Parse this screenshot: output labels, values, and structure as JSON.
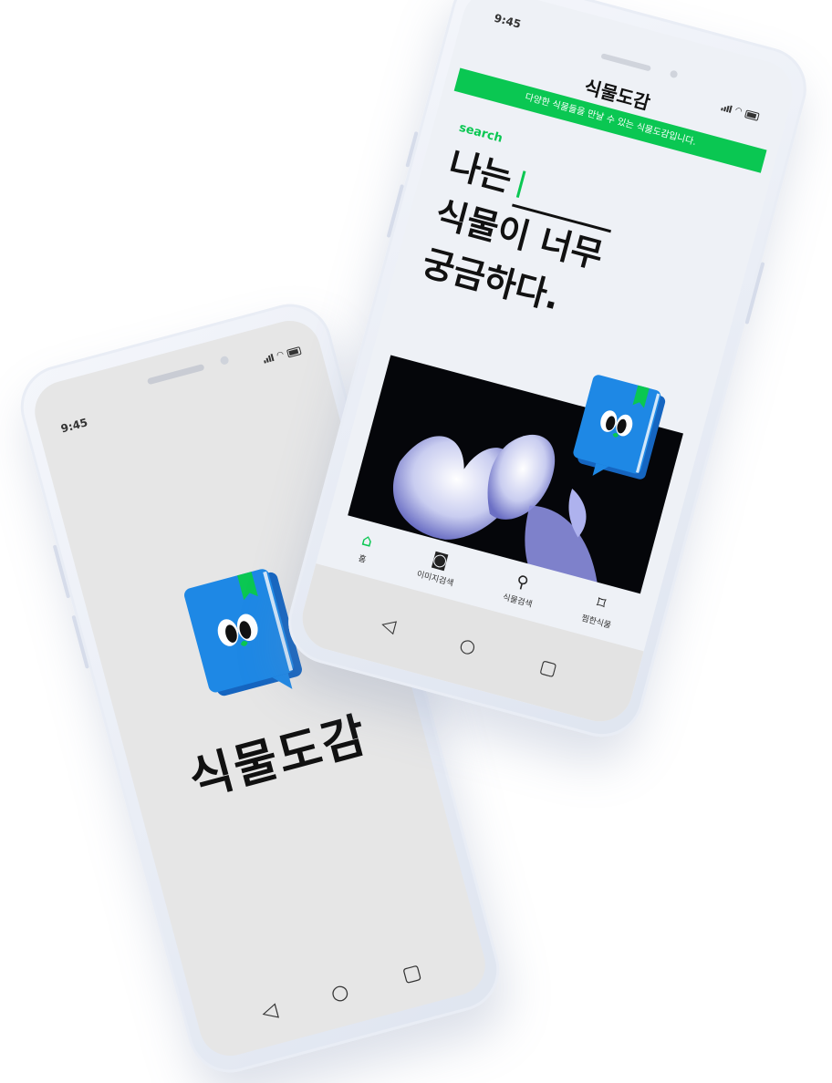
{
  "splash_phone": {
    "time": "9:45",
    "app_name": "식물도감",
    "nav": {
      "back_icon": "triangle-back-icon",
      "home_icon": "circle-home-icon",
      "recent_icon": "square-recent-icon"
    }
  },
  "main_phone": {
    "time": "9:45",
    "title": "식물도감",
    "banner": "다양한 식물들을 만날 수 있는 식물도감입니다.",
    "search_label": "search",
    "headline": {
      "line1": "나는",
      "line2": "식물이 너무",
      "line3": "궁금하다."
    },
    "tabs": [
      {
        "label": "홈",
        "icon": "home-icon"
      },
      {
        "label": "이미지검색",
        "icon": "camera-icon"
      },
      {
        "label": "식물검색",
        "icon": "search-icon"
      },
      {
        "label": "찜한식물",
        "icon": "bookmark-icon"
      }
    ]
  },
  "colors": {
    "accent_green": "#0ac752",
    "book_blue": "#1e88e5",
    "splash_bg": "#e6e6e6"
  }
}
